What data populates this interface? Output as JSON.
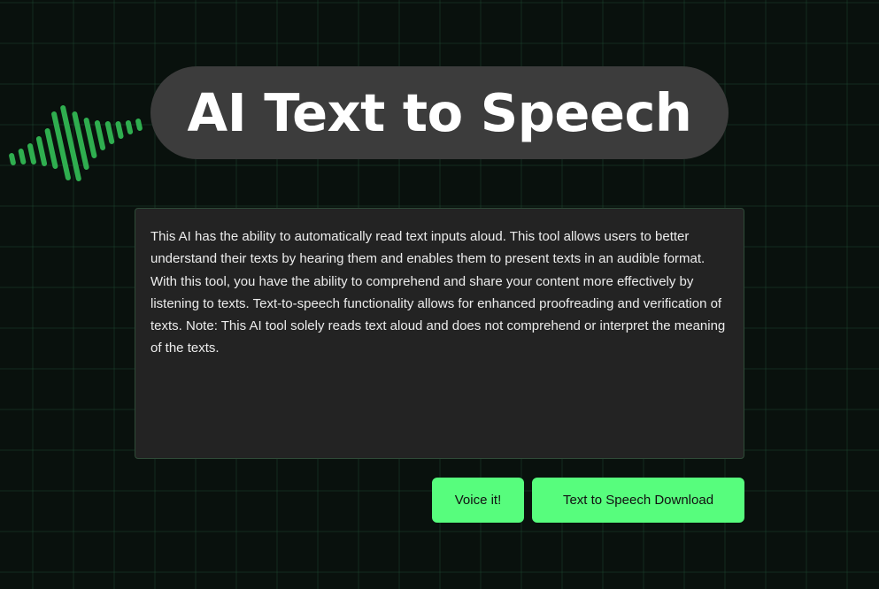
{
  "header": {
    "title": "AI Text to Speech"
  },
  "main": {
    "text_input_value": "This AI has the ability to automatically read text inputs aloud. This tool allows users to better understand their texts by hearing them and enables them to present texts in an audible format. With this tool, you have the ability to comprehend and share your content more effectively by listening to texts. Text-to-speech functionality allows for enhanced proofreading and verification of texts. Note: This AI tool solely reads text aloud and does not comprehend or interpret the meaning of the texts.",
    "voice_button": "Voice it!",
    "download_button": "Text to Speech Download"
  },
  "decorations": {
    "icon_left": "sound-wave-icon",
    "icon_right": "sound-wave-icon"
  },
  "colors": {
    "accent": "#57fd7d",
    "wave": "#2fae4f",
    "title_bg": "#3c3c3c",
    "panel_bg": "#232323",
    "background": "#09110d"
  }
}
